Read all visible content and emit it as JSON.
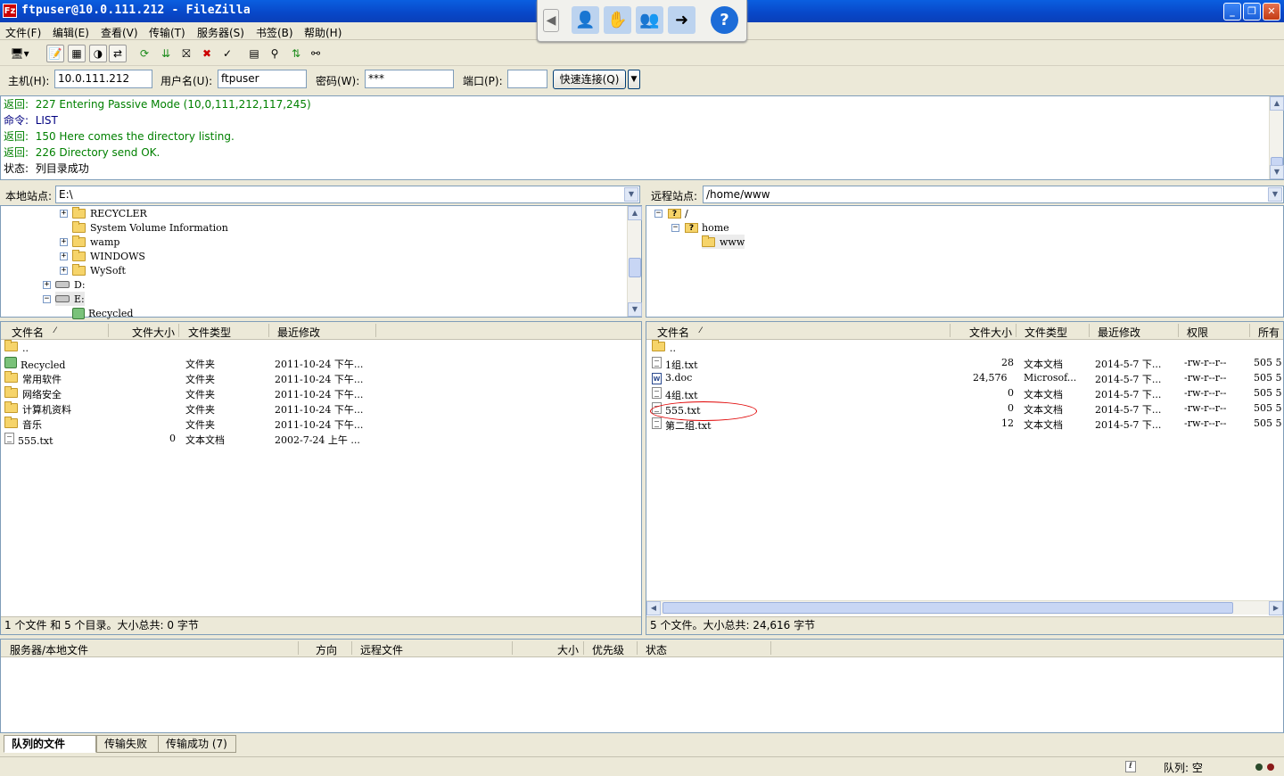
{
  "window": {
    "title": "ftpuser@10.0.111.212 - FileZilla",
    "app_icon": "Fz",
    "min": "_",
    "max": "❐",
    "close": "✕"
  },
  "menu": [
    "文件(F)",
    "编辑(E)",
    "查看(V)",
    "传输(T)",
    "服务器(S)",
    "书签(B)",
    "帮助(H)"
  ],
  "quickconnect": {
    "host_label": "主机(H):",
    "host_value": "10.0.111.212",
    "user_label": "用户名(U):",
    "user_value": "ftpuser",
    "pass_label": "密码(W):",
    "pass_value": "***",
    "port_label": "端口(P):",
    "port_value": "",
    "button": "快速连接(Q)"
  },
  "log": [
    {
      "prefix": "返回:",
      "text": "227 Entering Passive Mode (10,0,111,212,117,245)",
      "color": "#008000"
    },
    {
      "prefix": "命令:",
      "text": "LIST",
      "color": "#000080"
    },
    {
      "prefix": "返回:",
      "text": "150 Here comes the directory listing.",
      "color": "#008000"
    },
    {
      "prefix": "返回:",
      "text": "226 Directory send OK.",
      "color": "#008000"
    },
    {
      "prefix": "状态:",
      "text": "列目录成功",
      "color": "#000000"
    }
  ],
  "local": {
    "site_label": "本地站点:",
    "path": "E:\\",
    "tree": [
      "RECYCLER",
      "System Volume Information",
      "wamp",
      "WINDOWS",
      "WySoft",
      "D:",
      "E:",
      "Recycled"
    ],
    "columns": [
      "文件名",
      "文件大小",
      "文件类型",
      "最近修改"
    ],
    "files": [
      {
        "name": "..",
        "size": "",
        "type": "",
        "modified": ""
      },
      {
        "name": "Recycled",
        "size": "",
        "type": "文件夹",
        "modified": "2011-10-24 下午..."
      },
      {
        "name": "常用软件",
        "size": "",
        "type": "文件夹",
        "modified": "2011-10-24 下午..."
      },
      {
        "name": "网络安全",
        "size": "",
        "type": "文件夹",
        "modified": "2011-10-24 下午..."
      },
      {
        "name": "计算机资料",
        "size": "",
        "type": "文件夹",
        "modified": "2011-10-24 下午..."
      },
      {
        "name": "音乐",
        "size": "",
        "type": "文件夹",
        "modified": "2011-10-24 下午..."
      },
      {
        "name": "555.txt",
        "size": "0",
        "type": "文本文档",
        "modified": "2002-7-24 上午 ..."
      }
    ],
    "status": "1 个文件 和 5 个目录。大小总共: 0 字节"
  },
  "remote": {
    "site_label": "远程站点:",
    "path": "/home/www",
    "tree": [
      "/",
      "home",
      "www"
    ],
    "columns": [
      "文件名",
      "文件大小",
      "文件类型",
      "最近修改",
      "权限",
      "所有"
    ],
    "files": [
      {
        "name": "..",
        "size": "",
        "type": "",
        "modified": "",
        "perm": "",
        "owner": ""
      },
      {
        "name": "1组.txt",
        "size": "28",
        "type": "文本文档",
        "modified": "2014-5-7 下...",
        "perm": "-rw-r--r--",
        "owner": "505 5"
      },
      {
        "name": "3.doc",
        "size": "24,576",
        "type": "Microsof...",
        "modified": "2014-5-7 下...",
        "perm": "-rw-r--r--",
        "owner": "505 5"
      },
      {
        "name": "4组.txt",
        "size": "0",
        "type": "文本文档",
        "modified": "2014-5-7 下...",
        "perm": "-rw-r--r--",
        "owner": "505 5"
      },
      {
        "name": "555.txt",
        "size": "0",
        "type": "文本文档",
        "modified": "2014-5-7 下...",
        "perm": "-rw-r--r--",
        "owner": "505 5"
      },
      {
        "name": "第二组.txt",
        "size": "12",
        "type": "文本文档",
        "modified": "2014-5-7 下...",
        "perm": "-rw-r--r--",
        "owner": "505 5"
      }
    ],
    "status": "5 个文件。大小总共: 24,616 字节"
  },
  "queue": {
    "columns": [
      "服务器/本地文件",
      "方向",
      "远程文件",
      "大小",
      "优先级",
      "状态"
    ],
    "tabs": [
      "队列的文件",
      "传输失败",
      "传输成功 (7)"
    ]
  },
  "statusbar": {
    "queue": "队列: 空"
  },
  "colors": {
    "log_green": "#008000",
    "selection_circle": "#e00000",
    "title_blue": "#0a5fe0"
  }
}
